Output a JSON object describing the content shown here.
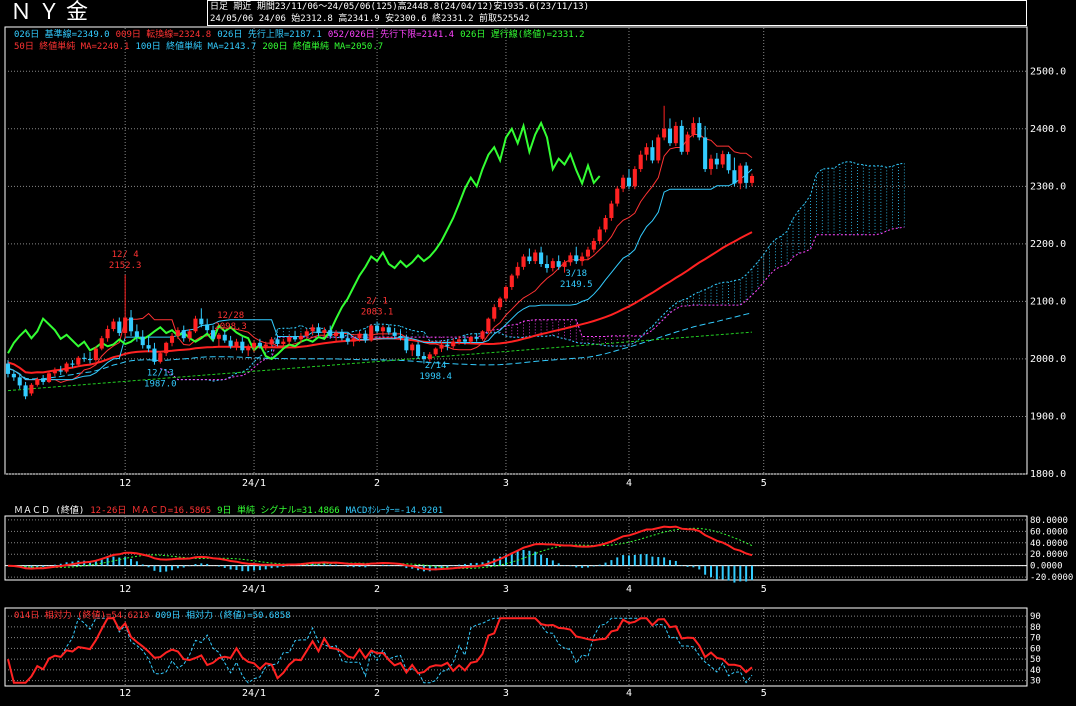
{
  "header": {
    "title": "ＮＹ金",
    "period_label": "日足  期近",
    "period_info": "期間23/11/06～24/05/06(125)高2448.8(24/04/12)安1935.6(23/11/13)",
    "last_bar": "24/05/06 24/06 始2312.8 高2341.9 安2300.6 終2331.2 前取525542"
  },
  "legend_main_row1": [
    {
      "text": "026日 基準線=2349.0",
      "color": "#33ccff"
    },
    {
      "text": "009日 転換線=2324.8",
      "color": "#ff3333"
    },
    {
      "text": "026日 先行上限=2187.1",
      "color": "#33ccff"
    },
    {
      "text": "052/026日 先行下限=2141.4",
      "color": "#ff44ff"
    },
    {
      "text": "026日 遅行線(終値)=2331.2",
      "color": "#33ff33"
    }
  ],
  "legend_main_row2": [
    {
      "text": "50日 終値単純 MA=2240.1",
      "color": "#ff3333"
    },
    {
      "text": "100日 終値単純 MA=2143.7",
      "color": "#33ccff"
    },
    {
      "text": "200日 終値単純 MA=2050.7",
      "color": "#33ff33"
    }
  ],
  "legend_macd": [
    {
      "text": "ＭＡＣＤ (終値)",
      "color": "#ffffff"
    },
    {
      "text": "12-26日 ＭＡＣＤ=16.5865",
      "color": "#ff3333"
    },
    {
      "text": "9日 単純 シグナル=31.4866",
      "color": "#33ff33"
    },
    {
      "text": "MACDｵｼﾚｰﾀｰ=-14.9201",
      "color": "#33ccff"
    }
  ],
  "legend_rsi": [
    {
      "text": "014日 相対力 (終値)=54.6219",
      "color": "#ff3333"
    },
    {
      "text": "009日 相対力 (終値)=50.6858",
      "color": "#33ccff"
    }
  ],
  "colors": {
    "up": "#ff2222",
    "down": "#33ccff",
    "ma50": "#ff2222",
    "ma100": "#33ccff",
    "ma200": "#22cc22",
    "chikou": "#33ff33",
    "kijun": "#33ccff",
    "tenkan": "#ff3333",
    "cloud_a": "#33ccff",
    "cloud_b": "#ff44ff"
  },
  "chart_data": [
    {
      "type": "candlestick",
      "ylim": [
        1800,
        2530
      ],
      "yticks": [
        1800,
        1900,
        2000,
        2100,
        2200,
        2300,
        2400,
        2500
      ],
      "ytick_labels": [
        "1800.0",
        "1900.0",
        "2000.0",
        "2100.0",
        "2200.0",
        "2300.0",
        "2400.0",
        "2500.0"
      ],
      "xtick_labels": [
        "12",
        "24/1",
        "2",
        "3",
        "4",
        "5"
      ],
      "xtick_index": [
        20,
        42,
        63,
        85,
        106,
        129
      ],
      "ohlc": [
        [
          1992,
          1998,
          1968,
          1974
        ],
        [
          1974,
          1980,
          1962,
          1968
        ],
        [
          1968,
          1972,
          1948,
          1954
        ],
        [
          1954,
          1960,
          1930,
          1935
        ],
        [
          1940,
          1958,
          1936,
          1955
        ],
        [
          1955,
          1968,
          1952,
          1965
        ],
        [
          1965,
          1972,
          1955,
          1960
        ],
        [
          1960,
          1978,
          1958,
          1975
        ],
        [
          1975,
          1985,
          1970,
          1980
        ],
        [
          1980,
          1988,
          1972,
          1978
        ],
        [
          1978,
          1995,
          1975,
          1992
        ],
        [
          1992,
          1998,
          1985,
          1990
        ],
        [
          1990,
          2005,
          1988,
          2002
        ],
        [
          2002,
          2010,
          1995,
          2000
        ],
        [
          2000,
          2012,
          1992,
          1998
        ],
        [
          1998,
          2022,
          1995,
          2018
        ],
        [
          2018,
          2040,
          2015,
          2036
        ],
        [
          2036,
          2058,
          2030,
          2052
        ],
        [
          2052,
          2070,
          2048,
          2065
        ],
        [
          2065,
          2072,
          2040,
          2045
        ],
        [
          2045,
          2146,
          2035,
          2072
        ],
        [
          2072,
          2085,
          2040,
          2048
        ],
        [
          2048,
          2060,
          2030,
          2038
        ],
        [
          2038,
          2050,
          2018,
          2024
        ],
        [
          2024,
          2040,
          2012,
          2018
        ],
        [
          2018,
          2028,
          1990,
          1995
        ],
        [
          1995,
          2012,
          1992,
          2010
        ],
        [
          2010,
          2030,
          2005,
          2028
        ],
        [
          2028,
          2045,
          2022,
          2040
        ],
        [
          2040,
          2055,
          2035,
          2050
        ],
        [
          2050,
          2058,
          2030,
          2036
        ],
        [
          2036,
          2052,
          2030,
          2048
        ],
        [
          2048,
          2075,
          2045,
          2070
        ],
        [
          2070,
          2088,
          2055,
          2060
        ],
        [
          2060,
          2070,
          2045,
          2050
        ],
        [
          2050,
          2058,
          2030,
          2035
        ],
        [
          2035,
          2045,
          2020,
          2042
        ],
        [
          2042,
          2050,
          2028,
          2032
        ],
        [
          2032,
          2040,
          2018,
          2022
        ],
        [
          2022,
          2035,
          2015,
          2030
        ],
        [
          2030,
          2038,
          2010,
          2015
        ],
        [
          2015,
          2025,
          2005,
          2020
        ],
        [
          2020,
          2032,
          2012,
          2028
        ],
        [
          2028,
          2035,
          2018,
          2022
        ],
        [
          2022,
          2030,
          2015,
          2025
        ],
        [
          2025,
          2038,
          2020,
          2034
        ],
        [
          2034,
          2040,
          2022,
          2026
        ],
        [
          2026,
          2035,
          2020,
          2030
        ],
        [
          2030,
          2042,
          2025,
          2038
        ],
        [
          2038,
          2048,
          2030,
          2034
        ],
        [
          2034,
          2045,
          2028,
          2040
        ],
        [
          2040,
          2052,
          2035,
          2048
        ],
        [
          2048,
          2060,
          2042,
          2055
        ],
        [
          2055,
          2062,
          2040,
          2045
        ],
        [
          2045,
          2055,
          2038,
          2050
        ],
        [
          2050,
          2058,
          2035,
          2040
        ],
        [
          2040,
          2050,
          2030,
          2046
        ],
        [
          2046,
          2052,
          2032,
          2036
        ],
        [
          2036,
          2045,
          2025,
          2030
        ],
        [
          2030,
          2040,
          2022,
          2036
        ],
        [
          2036,
          2048,
          2030,
          2044
        ],
        [
          2044,
          2050,
          2028,
          2032
        ],
        [
          2032,
          2060,
          2030,
          2058
        ],
        [
          2058,
          2065,
          2045,
          2048
        ],
        [
          2048,
          2058,
          2040,
          2055
        ],
        [
          2055,
          2060,
          2042,
          2046
        ],
        [
          2046,
          2054,
          2035,
          2040
        ],
        [
          2040,
          2050,
          2032,
          2036
        ],
        [
          2036,
          2042,
          2010,
          2015
        ],
        [
          2015,
          2028,
          2005,
          2025
        ],
        [
          2025,
          2030,
          2000,
          2005
        ],
        [
          2005,
          2012,
          1992,
          2000
        ],
        [
          2000,
          2012,
          1995,
          2008
        ],
        [
          2008,
          2020,
          2005,
          2018
        ],
        [
          2018,
          2030,
          2012,
          2025
        ],
        [
          2025,
          2032,
          2015,
          2022
        ],
        [
          2022,
          2035,
          2018,
          2030
        ],
        [
          2030,
          2040,
          2025,
          2034
        ],
        [
          2034,
          2040,
          2025,
          2030
        ],
        [
          2030,
          2040,
          2026,
          2038
        ],
        [
          2038,
          2045,
          2030,
          2035
        ],
        [
          2035,
          2050,
          2032,
          2048
        ],
        [
          2048,
          2072,
          2045,
          2070
        ],
        [
          2070,
          2095,
          2065,
          2090
        ],
        [
          2090,
          2108,
          2085,
          2105
        ],
        [
          2105,
          2128,
          2100,
          2125
        ],
        [
          2125,
          2148,
          2120,
          2145
        ],
        [
          2145,
          2168,
          2140,
          2160
        ],
        [
          2160,
          2182,
          2155,
          2178
        ],
        [
          2178,
          2192,
          2165,
          2170
        ],
        [
          2170,
          2190,
          2165,
          2185
        ],
        [
          2185,
          2195,
          2160,
          2165
        ],
        [
          2165,
          2180,
          2150,
          2158
        ],
        [
          2158,
          2175,
          2152,
          2170
        ],
        [
          2170,
          2180,
          2155,
          2160
        ],
        [
          2160,
          2172,
          2150,
          2168
        ],
        [
          2168,
          2185,
          2162,
          2180
        ],
        [
          2180,
          2195,
          2165,
          2170
        ],
        [
          2170,
          2185,
          2162,
          2178
        ],
        [
          2178,
          2195,
          2172,
          2190
        ],
        [
          2190,
          2210,
          2185,
          2205
        ],
        [
          2205,
          2230,
          2200,
          2225
        ],
        [
          2225,
          2250,
          2220,
          2245
        ],
        [
          2245,
          2275,
          2240,
          2270
        ],
        [
          2270,
          2300,
          2265,
          2296
        ],
        [
          2296,
          2320,
          2290,
          2315
        ],
        [
          2315,
          2330,
          2295,
          2300
        ],
        [
          2300,
          2335,
          2295,
          2330
        ],
        [
          2330,
          2362,
          2325,
          2355
        ],
        [
          2355,
          2375,
          2345,
          2368
        ],
        [
          2368,
          2380,
          2340,
          2345
        ],
        [
          2345,
          2390,
          2340,
          2385
        ],
        [
          2385,
          2440,
          2380,
          2400
        ],
        [
          2400,
          2418,
          2370,
          2375
        ],
        [
          2375,
          2412,
          2370,
          2405
        ],
        [
          2405,
          2415,
          2355,
          2360
        ],
        [
          2360,
          2395,
          2355,
          2390
        ],
        [
          2390,
          2420,
          2385,
          2410
        ],
        [
          2410,
          2420,
          2380,
          2385
        ],
        [
          2385,
          2405,
          2325,
          2330
        ],
        [
          2330,
          2355,
          2320,
          2348
        ],
        [
          2348,
          2358,
          2330,
          2338
        ],
        [
          2338,
          2362,
          2332,
          2356
        ],
        [
          2356,
          2360,
          2322,
          2328
        ],
        [
          2328,
          2350,
          2300,
          2305
        ],
        [
          2305,
          2340,
          2295,
          2336
        ],
        [
          2336,
          2342,
          2296,
          2306
        ],
        [
          2306,
          2322,
          2300,
          2318
        ]
      ],
      "annotations": [
        {
          "index": 20,
          "date": "12/ 4",
          "price": "2152.3"
        },
        {
          "index": 38,
          "date": "12/28",
          "price": "2098.3"
        },
        {
          "index": 63,
          "date": "2/ 1",
          "price": "2083.1"
        },
        {
          "index": 26,
          "date": "12/13",
          "price": "1987.0"
        },
        {
          "index": 73,
          "date": "2/14",
          "price": "1998.4"
        },
        {
          "index": 97,
          "date": "3/18",
          "price": "2149.5"
        }
      ]
    },
    {
      "type": "line",
      "title": "ＭＡＣＤ (終値)",
      "ylim": [
        -25,
        85
      ],
      "yticks": [
        -20,
        0,
        20,
        40,
        60,
        80
      ],
      "ytick_labels": [
        "-20.0000",
        "0.0000",
        "20.0000",
        "40.0000",
        "60.0000",
        "80.0000"
      ]
    },
    {
      "type": "line",
      "title": "相対力",
      "ylim": [
        25,
        92
      ],
      "yticks": [
        30,
        40,
        50,
        60,
        70,
        80,
        90
      ],
      "ytick_labels": [
        "30",
        "40",
        "50",
        "60",
        "70",
        "80",
        "90"
      ]
    }
  ]
}
